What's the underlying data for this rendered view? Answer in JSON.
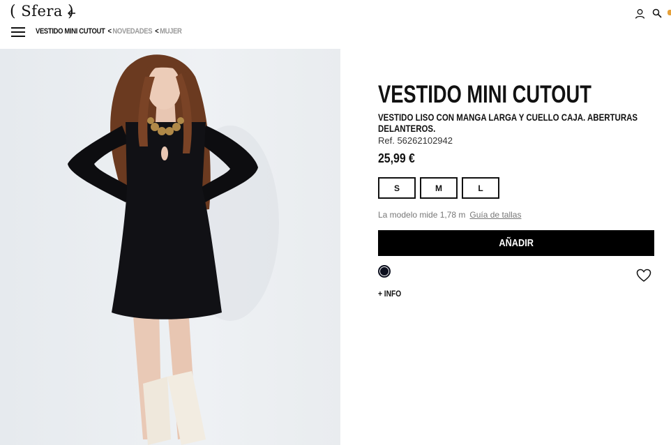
{
  "header": {
    "logo": "Sfera",
    "breadcrumb": {
      "current": "VESTIDO MINI CUTOUT",
      "separator": "<",
      "items": [
        "NOVEDADES",
        "MUJER"
      ]
    }
  },
  "icons": {
    "back": "arrow-left-icon",
    "menu": "hamburger-menu-icon",
    "user": "user-icon",
    "search": "search-icon",
    "wishlist": "heart-icon"
  },
  "product": {
    "title": "VESTIDO MINI CUTOUT",
    "description": "VESTIDO LISO CON MANGA LARGA Y CUELLO CAJA. ABERTURAS DELANTEROS.",
    "ref": "Ref. 56262102942",
    "price": "25,99 €",
    "sizes": [
      "S",
      "M",
      "L"
    ],
    "model_note": "La modelo mide 1,78 m",
    "size_guide": "Guía de tallas",
    "add_button": "AÑADIR",
    "more_info": "+ INFO",
    "color_swatch": "#0c0f1e"
  },
  "colors": {
    "accent": "#000000",
    "breadcrumb_muted": "#9a9a9a",
    "cart_badge": "#e6a13a"
  }
}
